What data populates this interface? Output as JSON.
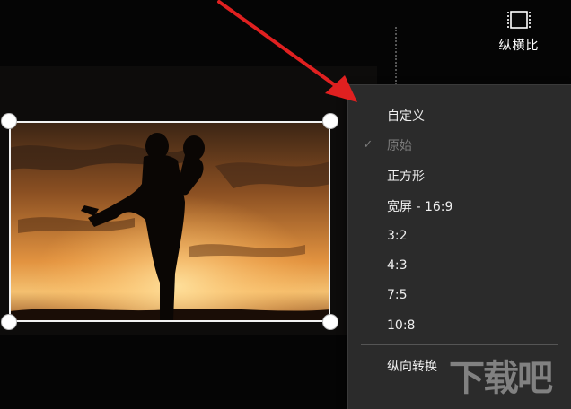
{
  "toolbar": {
    "aspect_ratio_label": "纵横比",
    "aspect_ratio_icon": "aspect-ratio-icon"
  },
  "aspect_menu": {
    "items": [
      {
        "label": "自定义",
        "checked": false,
        "enabled": true
      },
      {
        "label": "原始",
        "checked": true,
        "enabled": false
      },
      {
        "label": "正方形",
        "checked": false,
        "enabled": true
      },
      {
        "label": "宽屏 - 16:9",
        "checked": false,
        "enabled": true
      },
      {
        "label": "3:2",
        "checked": false,
        "enabled": true
      },
      {
        "label": "4:3",
        "checked": false,
        "enabled": true
      },
      {
        "label": "7:5",
        "checked": false,
        "enabled": true
      },
      {
        "label": "10:8",
        "checked": false,
        "enabled": true
      }
    ],
    "rotate_label": "纵向转换",
    "check_glyph": "✓"
  },
  "watermark": {
    "text": "下载吧"
  },
  "colors": {
    "menu_bg": "#2b2b2b",
    "arrow": "#e02020",
    "sunset_top": "#6a3a1a",
    "sunset_glow": "#f0a040"
  }
}
